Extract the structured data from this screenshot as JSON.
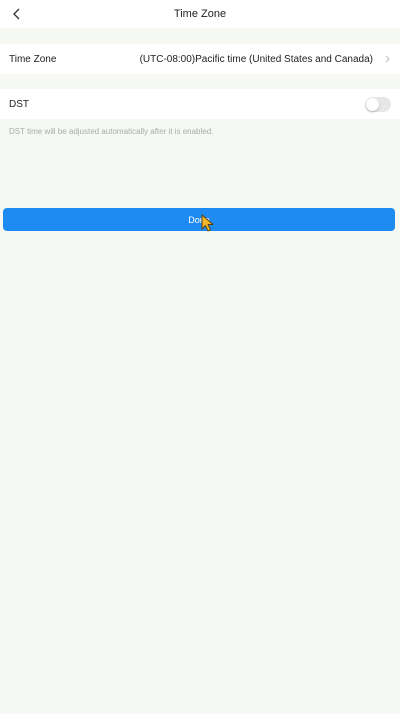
{
  "header": {
    "title": "Time Zone",
    "back_icon": "chevron-left-icon"
  },
  "timezone_row": {
    "label": "Time Zone",
    "value": "(UTC-08:00)Pacific time (United States and Canada)",
    "chevron_icon": "chevron-right-icon"
  },
  "dst_row": {
    "label": "DST",
    "enabled": false
  },
  "hint": "DST time will be adjusted automatically after it is enabled.",
  "done_button": {
    "label": "Done"
  },
  "colors": {
    "accent": "#1e8bf2",
    "background": "#f6f8f4",
    "hint_text": "#a9aca9"
  }
}
